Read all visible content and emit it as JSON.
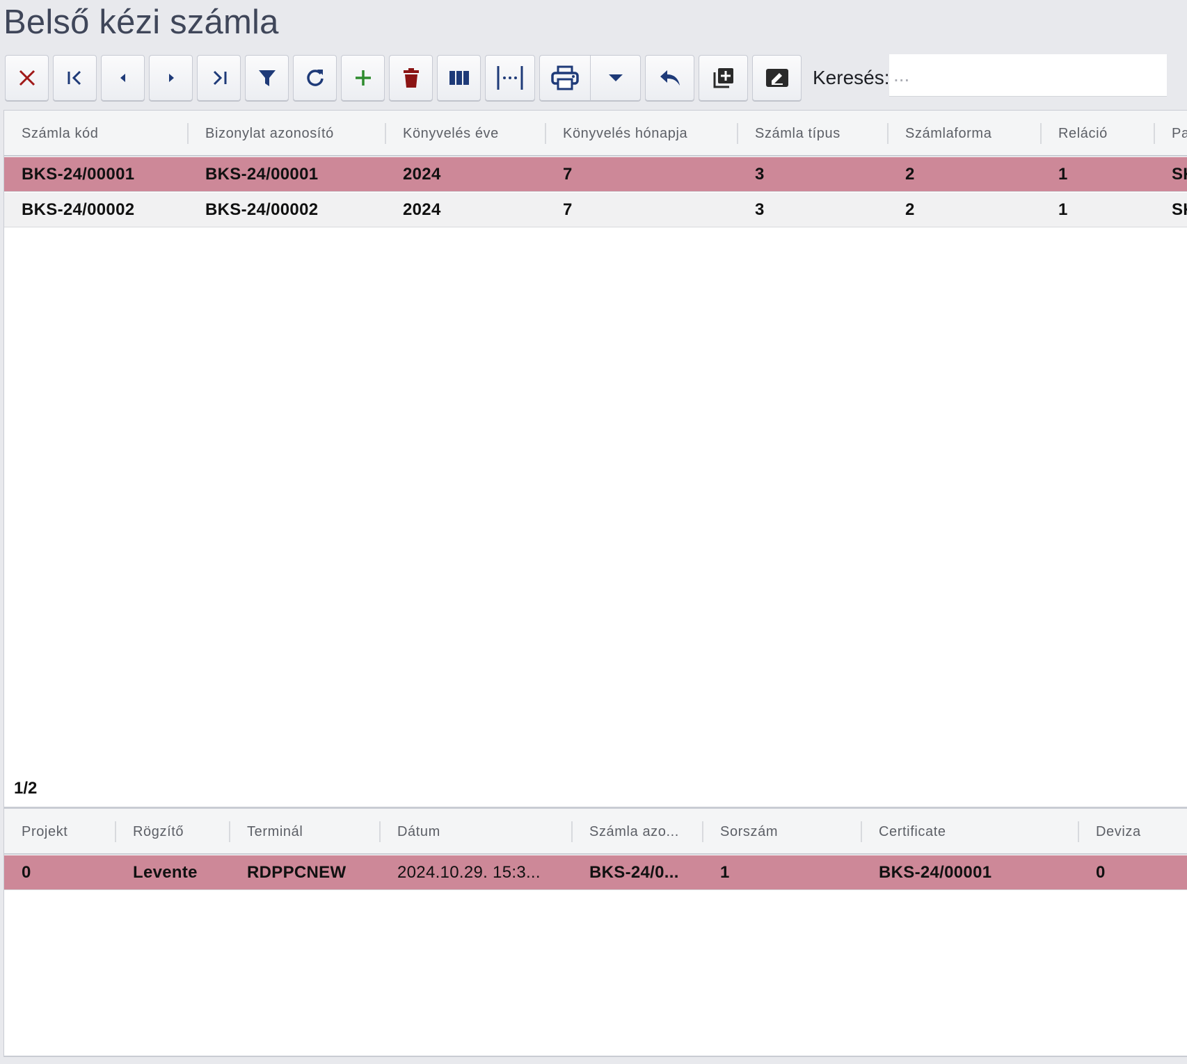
{
  "title": "Belső kézi számla",
  "toolbar": {
    "search_label": "Keresés:",
    "search_placeholder": "...",
    "buttons": [
      {
        "icon": "close-icon",
        "color": "#a01818"
      },
      {
        "icon": "first-record-icon",
        "color": "#1e3a78"
      },
      {
        "icon": "previous-record-icon",
        "color": "#1e3a78"
      },
      {
        "icon": "next-record-icon",
        "color": "#1e3a78"
      },
      {
        "icon": "last-record-icon",
        "color": "#1e3a78"
      },
      {
        "icon": "filter-icon",
        "color": "#1e3a78"
      },
      {
        "icon": "refresh-icon",
        "color": "#1e3a78"
      },
      {
        "icon": "add-icon",
        "color": "#2e8b2e"
      },
      {
        "icon": "trash-icon",
        "color": "#8b1414"
      },
      {
        "icon": "columns-icon",
        "color": "#1e3a78"
      },
      {
        "icon": "column-width-icon",
        "color": "#1e3a78"
      },
      {
        "icon": "print-icon",
        "color": "#1e3a78"
      },
      {
        "icon": "print-dropdown-icon",
        "color": "#1e3a78"
      },
      {
        "icon": "undo-icon",
        "color": "#1e3a78"
      },
      {
        "icon": "add-copy-icon",
        "color": "#2a2a2a"
      },
      {
        "icon": "signature-icon",
        "color": "#2a2a2a"
      }
    ]
  },
  "main_grid": {
    "columns": [
      "Számla kód",
      "Bizonylat azonosító",
      "Könyvelés éve",
      "Könyvelés hónapja",
      "Számla típus",
      "Számlaforma",
      "Reláció",
      "Pa"
    ],
    "rows": [
      {
        "cells": [
          "BKS-24/00001",
          "BKS-24/00001",
          "2024",
          "7",
          "3",
          "2",
          "1",
          "SK"
        ],
        "selected": true
      },
      {
        "cells": [
          "BKS-24/00002",
          "BKS-24/00002",
          "2024",
          "7",
          "3",
          "2",
          "1",
          "SK"
        ],
        "selected": false
      }
    ],
    "pager": "1/2"
  },
  "detail_grid": {
    "columns": [
      "Projekt",
      "Rögzítő",
      "Terminál",
      "Dátum",
      "Számla azo...",
      "Sorszám",
      "Certificate",
      "Deviza"
    ],
    "rows": [
      {
        "cells": [
          "0",
          "Levente",
          "RDPPCNEW",
          "2024.10.29. 15:3...",
          "BKS-24/0...",
          "1",
          "BKS-24/00001",
          "0"
        ],
        "selected": true
      }
    ]
  },
  "colors": {
    "selected_row": "#cd8898",
    "title_text": "#3f4659",
    "icon_blue": "#1e3a78"
  }
}
